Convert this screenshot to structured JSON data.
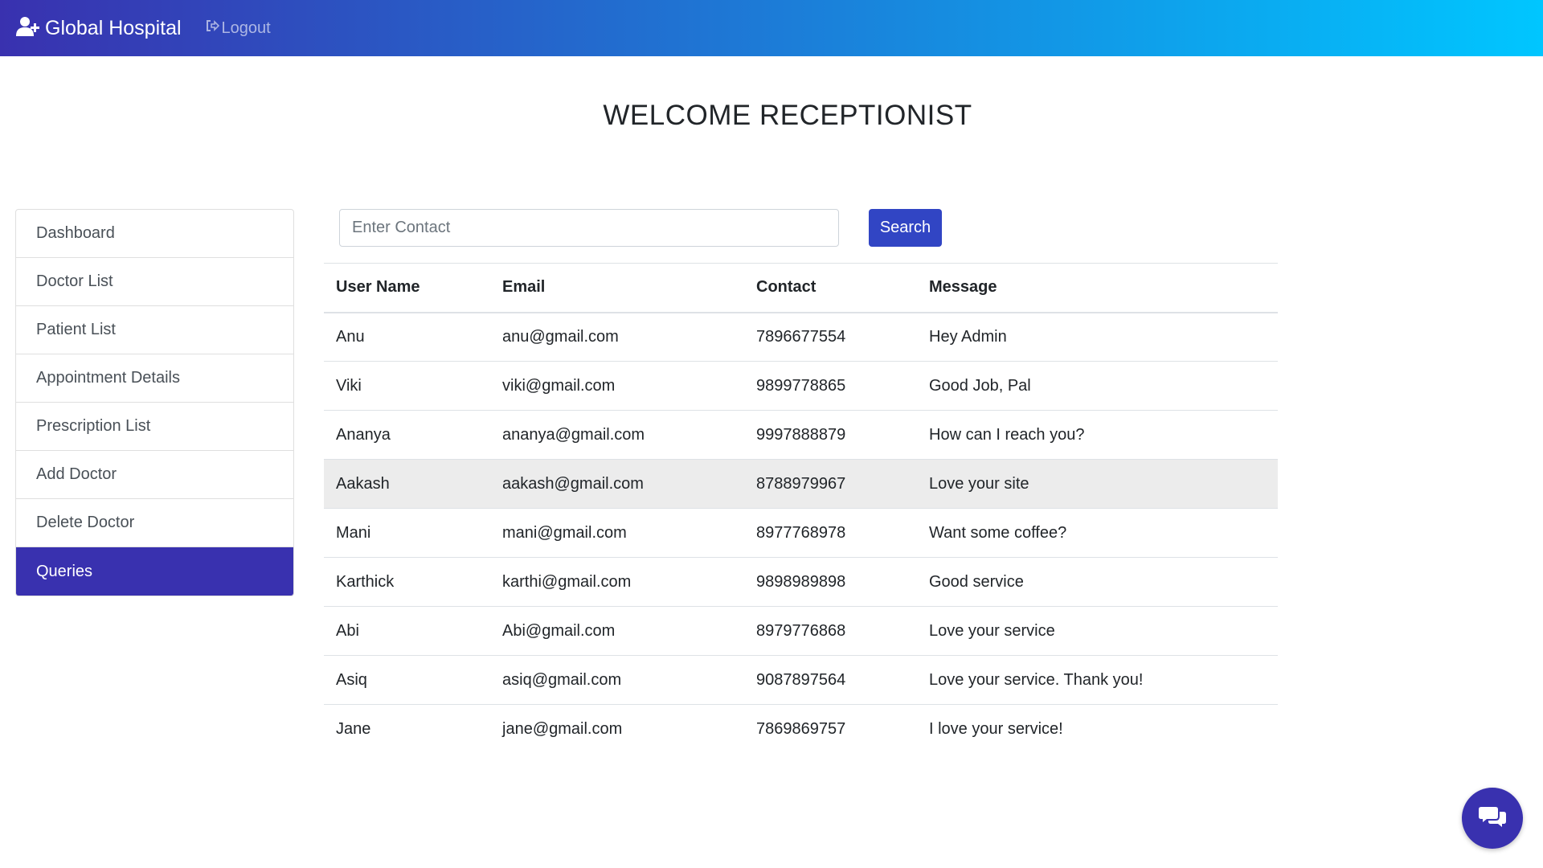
{
  "navbar": {
    "brand": "Global Hospital",
    "logout_label": "Logout",
    "gradient_start": "#3931af",
    "gradient_end": "#00c6ff",
    "brand_icon": "user-plus-icon",
    "logout_icon": "sign-out-icon"
  },
  "welcome": "WELCOME RECEPTIONIST",
  "sidebar": {
    "items": [
      {
        "label": "Dashboard"
      },
      {
        "label": "Doctor List"
      },
      {
        "label": "Patient List"
      },
      {
        "label": "Appointment Details"
      },
      {
        "label": "Prescription List"
      },
      {
        "label": "Add Doctor"
      },
      {
        "label": "Delete Doctor"
      },
      {
        "label": "Queries",
        "active": true
      }
    ],
    "active_color": "#3931af"
  },
  "search": {
    "placeholder": "Enter Contact",
    "value": "",
    "button_label": "Search",
    "button_color": "#3145c4"
  },
  "table": {
    "headers": [
      "User Name",
      "Email",
      "Contact",
      "Message"
    ],
    "rows": [
      {
        "user": "Anu",
        "email": "anu@gmail.com",
        "contact": "7896677554",
        "message": "Hey Admin"
      },
      {
        "user": "Viki",
        "email": "viki@gmail.com",
        "contact": "9899778865",
        "message": "Good Job, Pal"
      },
      {
        "user": "Ananya",
        "email": "ananya@gmail.com",
        "contact": "9997888879",
        "message": "How can I reach you?"
      },
      {
        "user": "Aakash",
        "email": "aakash@gmail.com",
        "contact": "8788979967",
        "message": "Love your site",
        "highlighted": true
      },
      {
        "user": "Mani",
        "email": "mani@gmail.com",
        "contact": "8977768978",
        "message": "Want some coffee?"
      },
      {
        "user": "Karthick",
        "email": "karthi@gmail.com",
        "contact": "9898989898",
        "message": "Good service"
      },
      {
        "user": "Abi",
        "email": "Abi@gmail.com",
        "contact": "8979776868",
        "message": "Love your service"
      },
      {
        "user": "Asiq",
        "email": "asiq@gmail.com",
        "contact": "9087897564",
        "message": "Love your service. Thank you!"
      },
      {
        "user": "Jane",
        "email": "jane@gmail.com",
        "contact": "7869869757",
        "message": "I love your service!"
      }
    ]
  },
  "chat_widget": {
    "icon": "chat-bubbles-icon",
    "color": "#3931af"
  }
}
